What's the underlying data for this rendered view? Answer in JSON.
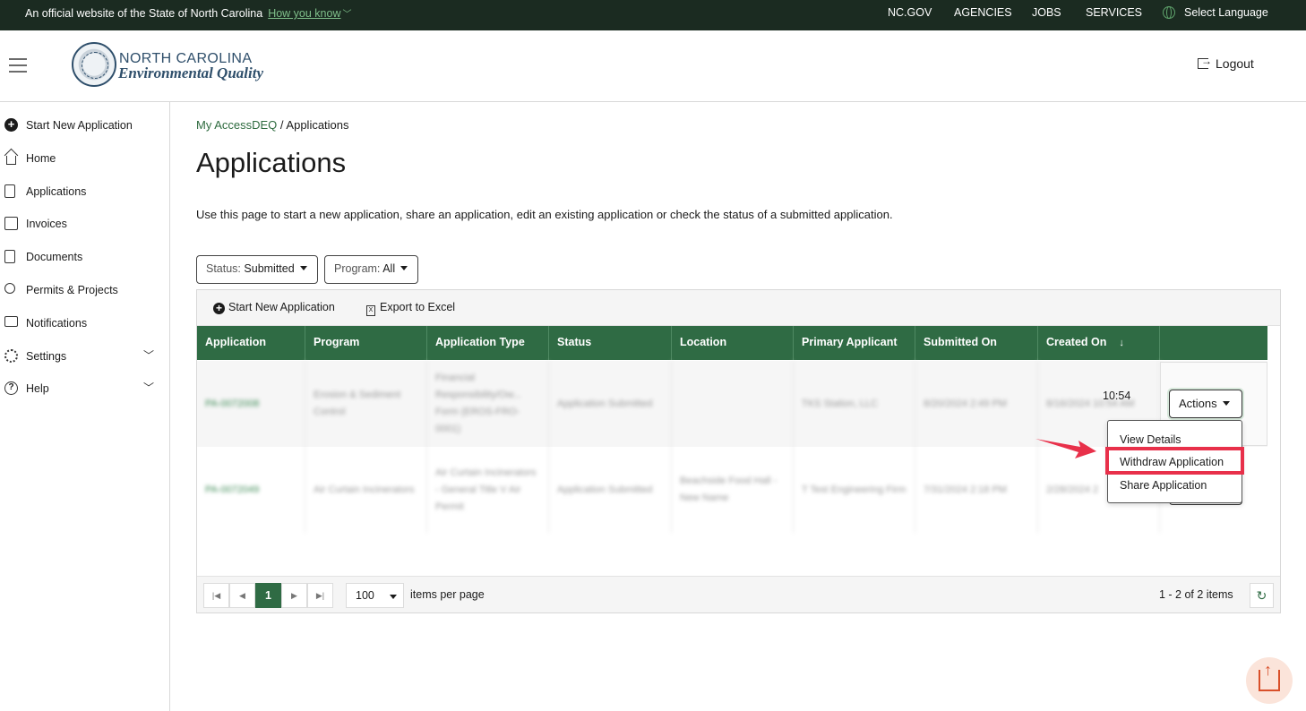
{
  "gov_bar": {
    "official_text": "An official website of the State of North Carolina",
    "how_you_know": "How you know",
    "links": [
      "NC.GOV",
      "AGENCIES",
      "JOBS",
      "SERVICES"
    ],
    "language": "Select Language"
  },
  "header": {
    "logo_line1": "NORTH CAROLINA",
    "logo_line2": "Environmental Quality",
    "logout": "Logout"
  },
  "sidebar": {
    "items": [
      {
        "label": "Start New Application",
        "icon": "plus-circle-icon"
      },
      {
        "label": "Home",
        "icon": "home-icon"
      },
      {
        "label": "Applications",
        "icon": "document-list-icon"
      },
      {
        "label": "Invoices",
        "icon": "invoice-icon"
      },
      {
        "label": "Documents",
        "icon": "pdf-document-icon"
      },
      {
        "label": "Permits & Projects",
        "icon": "award-icon"
      },
      {
        "label": "Notifications",
        "icon": "speech-bubble-icon"
      },
      {
        "label": "Settings",
        "icon": "gear-icon"
      },
      {
        "label": "Help",
        "icon": "help-circle-icon"
      }
    ]
  },
  "main": {
    "breadcrumb_link": "My AccessDEQ",
    "breadcrumb_sep": " / ",
    "breadcrumb_current": "Applications",
    "title": "Applications",
    "intro": "Use this page to start a new application, share an application, edit an existing application or check the status of a submitted application.",
    "filters": {
      "status_key": "Status:",
      "status_value": "Submitted",
      "program_key": "Program:",
      "program_value": "All"
    },
    "toolbar": {
      "start_new": "Start New Application",
      "export": "Export to Excel"
    },
    "columns": [
      "Application",
      "Program",
      "Application Type",
      "Status",
      "Location",
      "Primary Applicant",
      "Submitted On",
      "Created On"
    ],
    "rows": [
      {
        "application": "PA-0072008",
        "program": "Erosion & Sediment Control",
        "type": "Financial Responsibility/Ow... Form (EROS-FRO-0001)",
        "status": "Application Submitted",
        "location": "",
        "applicant": "TKS Station, LLC",
        "submitted": "8/20/2024 2:49 PM",
        "created": "8/16/2024 10:54 AM",
        "created_visible": "10:54"
      },
      {
        "application": "PA-0072049",
        "program": "Air Curtain Incinerators",
        "type": "Air Curtain Incinerators - General Title V Air Permit",
        "status": "Application Submitted",
        "location": "Beachside Food Hall - New Name",
        "applicant": "T Test Engineering Firm",
        "submitted": "7/31/2024 2:18 PM",
        "created": "2/28/2024 2",
        "created_visible": ""
      }
    ],
    "actions_label": "Actions",
    "actions_menu": [
      "View Details",
      "Withdraw Application",
      "Share Application"
    ],
    "pager": {
      "current_page": "1",
      "page_size": "100",
      "page_size_label": "items per page",
      "info": "1 - 2 of 2 items"
    }
  },
  "colors": {
    "header_green": "#2f6b44",
    "link_green": "#2e6b3f",
    "gov_bar": "#1b2b21",
    "highlight_red": "#e8304a"
  }
}
